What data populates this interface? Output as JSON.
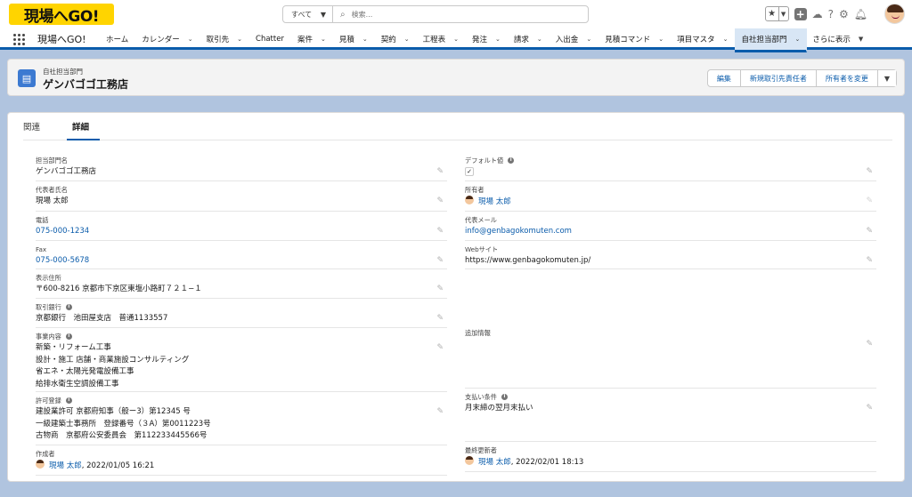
{
  "header": {
    "logo_text": "現場へGO!",
    "search_scope": "すべて",
    "search_placeholder": "検索..."
  },
  "nav": {
    "app_name": "現場へGO!",
    "items": [
      {
        "label": "ホーム",
        "chevron": false
      },
      {
        "label": "カレンダー",
        "chevron": true
      },
      {
        "label": "取引先",
        "chevron": true
      },
      {
        "label": "Chatter",
        "chevron": false
      },
      {
        "label": "案件",
        "chevron": true
      },
      {
        "label": "見積",
        "chevron": true
      },
      {
        "label": "契約",
        "chevron": true
      },
      {
        "label": "工程表",
        "chevron": true
      },
      {
        "label": "発注",
        "chevron": true
      },
      {
        "label": "請求",
        "chevron": true
      },
      {
        "label": "入出金",
        "chevron": true
      },
      {
        "label": "見積コマンド",
        "chevron": true
      },
      {
        "label": "項目マスタ",
        "chevron": true
      },
      {
        "label": "自社担当部門",
        "chevron": true,
        "active": true
      }
    ],
    "more_label": "さらに表示"
  },
  "record": {
    "type_label": "自社担当部門",
    "title": "ゲンバゴゴ工務店",
    "actions": [
      "編集",
      "新規取引先責任者",
      "所有者を変更"
    ]
  },
  "tabs": [
    "関連",
    "詳細"
  ],
  "fields_left": {
    "dept_name": {
      "label": "担当部門名",
      "value": "ゲンバゴゴ工務店"
    },
    "rep_name": {
      "label": "代表者氏名",
      "value": "現場 太郎"
    },
    "phone": {
      "label": "電話",
      "value": "075-000-1234"
    },
    "fax": {
      "label": "Fax",
      "value": "075-000-5678"
    },
    "address": {
      "label": "表示住所",
      "value": "〒600-8216 京都市下京区東塩小路町７２１−１"
    },
    "bank": {
      "label": "取引銀行",
      "value": "京都銀行　池田屋支店　普通1133557"
    },
    "business": {
      "label": "事業内容",
      "lines": [
        "新築・リフォーム工事",
        "設計・施工 店舗・商業施設コンサルティング",
        "省エネ・太陽光発電設備工事",
        "給排水衛生空調設備工事"
      ]
    },
    "license": {
      "label": "許可登録",
      "lines": [
        "建設業許可 京都府知事（般ー3）第12345 号",
        "一級建築士事務所　登録番号（３A）第0011223号",
        "古物商　京都府公安委員会　第112233445566号"
      ]
    },
    "created_by": {
      "label": "作成者",
      "user": "現場 太郎",
      "date": ", 2022/01/05 16:21"
    }
  },
  "fields_right": {
    "default": {
      "label": "デフォルト値",
      "checked": "✓"
    },
    "owner": {
      "label": "所有者",
      "user": "現場 太郎"
    },
    "email": {
      "label": "代表メール",
      "value": "info@genbagokomuten.com"
    },
    "website": {
      "label": "Webサイト",
      "value": "https://www.genbagokomuten.jp/"
    },
    "extra": {
      "label": "追加情報",
      "value": ""
    },
    "payment": {
      "label": "支払い条件",
      "value": "月末締の翌月末払い"
    },
    "modified_by": {
      "label": "最終更新者",
      "user": "現場 太郎",
      "date": ", 2022/02/01 18:13"
    }
  },
  "colors": {
    "brand_blue": "#0b5cab",
    "logo_yellow": "#ffd400",
    "page_bg": "#b0c4df"
  }
}
